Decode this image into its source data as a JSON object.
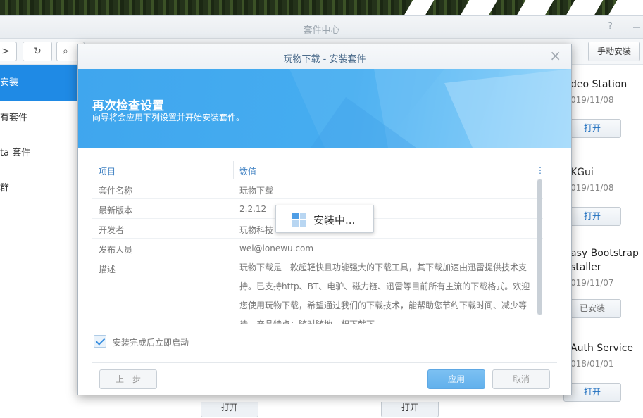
{
  "background_window": {
    "title": "套件中心",
    "help_icon": "?",
    "manual_install_label": "手动安装",
    "toolbar": {
      "forward_glyph": ">",
      "refresh_glyph": "C",
      "search_glyph": "Q"
    },
    "sidebar": [
      {
        "label": "安装",
        "active": true
      },
      {
        "label": "有套件",
        "active": false
      },
      {
        "label": "ta 套件",
        "active": false
      },
      {
        "label": "群",
        "active": false
      }
    ],
    "packages": [
      {
        "name": "deo Station",
        "date": "019/11/08",
        "button": "打开"
      },
      {
        "name": "KGui",
        "date": "019/11/08",
        "button": "打开"
      },
      {
        "name": "asy Bootstrap",
        "name2": "staller",
        "date": "019/11/07",
        "button": "已安装"
      },
      {
        "name": "Auth Service",
        "date": "018/01/01",
        "button": "打开"
      }
    ],
    "bottom_buttons": [
      "打开",
      "打开"
    ]
  },
  "dialog": {
    "title": "玩物下载 - 安装套件",
    "close_glyph": "×",
    "heading": "再次检查设置",
    "subheading": "向导将会应用下列设置并开始安装套件。",
    "table": {
      "col_item": "项目",
      "col_value": "数值",
      "col_menu_glyph": "⋮",
      "rows": [
        {
          "key": "套件名称",
          "value": "玩物下载"
        },
        {
          "key": "最新版本",
          "value": "2.2.12"
        },
        {
          "key": "开发者",
          "value": "玩物科技"
        },
        {
          "key": "发布人员",
          "value": "wei@ionewu.com"
        },
        {
          "key": "描述",
          "value": "玩物下载是一款超轻快且功能强大的下载工具，其下载加速由迅雷提供技术支持。已支持http、BT、电驴、磁力链、迅雷等目前所有主流的下载格式。欢迎您使用玩物下载，希望通过我们的下载技术，能帮助您节约下载时间、减少等待。产品特点：随时随地，想下就下"
        }
      ]
    },
    "installing_popup": "安装中...",
    "start_after_install": {
      "label": "安装完成后立即启动",
      "checked": true
    },
    "buttons": {
      "back": "上一步",
      "apply": "应用",
      "cancel": "取消"
    },
    "colors": {
      "accent": "#1f8ae5",
      "banner": "#46adf0"
    }
  }
}
